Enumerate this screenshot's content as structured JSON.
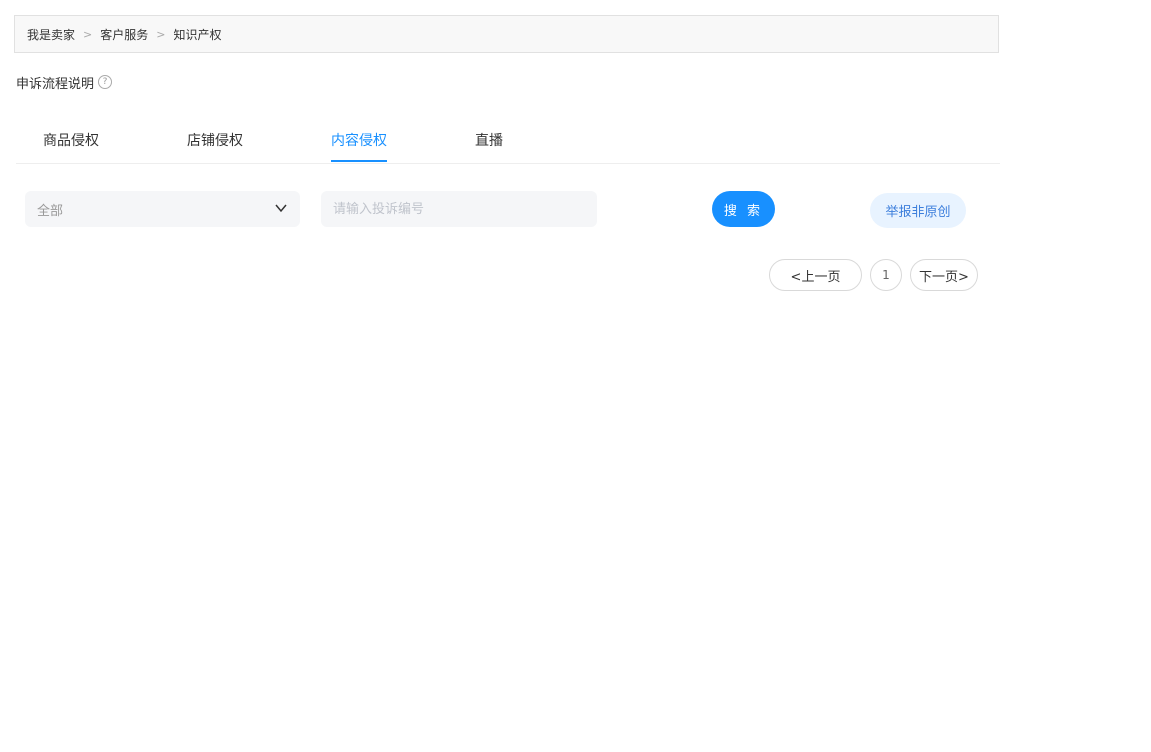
{
  "breadcrumb": {
    "items": [
      "我是卖家",
      "客户服务",
      "知识产权"
    ],
    "separator": ">"
  },
  "process": {
    "label": "申诉流程说明",
    "help_icon": "question-circle-icon"
  },
  "tabs": [
    {
      "label": "商品侵权",
      "active": false
    },
    {
      "label": "店铺侵权",
      "active": false
    },
    {
      "label": "内容侵权",
      "active": true
    },
    {
      "label": "直播",
      "active": false
    }
  ],
  "filter": {
    "select_value": "全部",
    "select_icon": "chevron-down-icon",
    "search_placeholder": "请输入投诉编号",
    "search_label": "搜 索",
    "report_label": "举报非原创"
  },
  "pagination": {
    "prev_label": "<上一页",
    "current_page": "1",
    "next_label": "下一页>"
  },
  "colors": {
    "accent": "#1890ff",
    "report_bg": "#e8f3ff",
    "report_text": "#3d7fdc"
  }
}
